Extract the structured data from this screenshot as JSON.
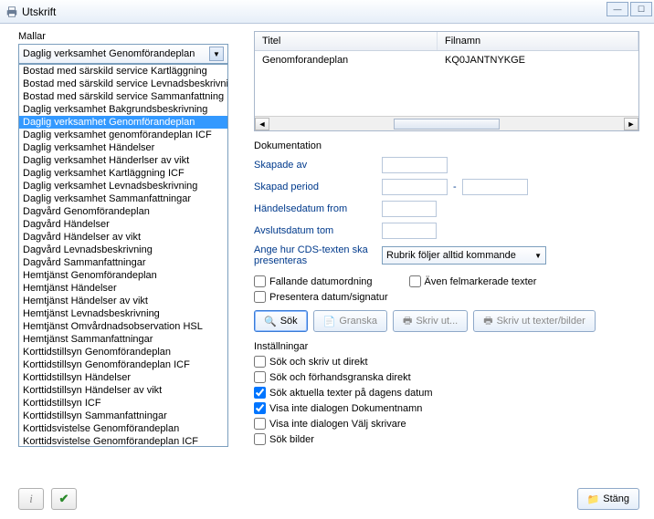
{
  "window": {
    "title": "Utskrift"
  },
  "mallar": {
    "label": "Mallar",
    "selected": "Daglig verksamhet Genomförandeplan",
    "items": [
      "Bostad med särskild service Kartläggning",
      "Bostad med särskild service Levnadsbeskrivning",
      "Bostad med särskild service Sammanfattning",
      "Daglig verksamhet Bakgrundsbeskrivning",
      "Daglig verksamhet Genomförandeplan",
      "Daglig verksamhet genomförandeplan ICF",
      "Daglig verksamhet Händelser",
      "Daglig verksamhet Händerlser av vikt",
      "Daglig verksamhet Kartläggning ICF",
      "Daglig verksamhet Levnadsbeskrivning",
      "Daglig verksamhet Sammanfattningar",
      "Dagvård Genomförandeplan",
      "Dagvård Händelser",
      "Dagvård Händelser av vikt",
      "Dagvård Levnadsbeskrivning",
      "Dagvård Sammanfattningar",
      "Hemtjänst Genomförandeplan",
      "Hemtjänst Händelser",
      "Hemtjänst Händelser av vikt",
      "Hemtjänst Levnadsbeskrivning",
      "Hemtjänst Omvårdnadsobservation HSL",
      "Hemtjänst Sammanfattningar",
      "Korttidstillsyn Genomförandeplan",
      "Korttidstillsyn Genomförandeplan ICF",
      "Korttidstillsyn Händelser",
      "Korttidstillsyn Händelser av vikt",
      "Korttidstillsyn ICF",
      "Korttidstillsyn Sammanfattningar",
      "Korttidsvistelse Genomförandeplan",
      "Korttidsvistelse Genomförandeplan ICF"
    ],
    "selected_index": 4
  },
  "table": {
    "headers": [
      "Titel",
      "Filnamn"
    ],
    "rows": [
      [
        "Genomforandeplan",
        "KQ0JANTNYKGE"
      ]
    ]
  },
  "dokumentation": {
    "label": "Dokumentation",
    "skapade_av": "Skapade av",
    "skapad_period": "Skapad period",
    "handelsedatum": "Händelsedatum from",
    "avslutsdatum": "Avslutsdatum tom",
    "cds_label": "Ange hur CDS-texten ska presenteras",
    "cds_value": "Rubrik följer alltid kommande",
    "fallande": "Fallande datumordning",
    "aven_fel": "Även felmarkerade texter",
    "presentera": "Presentera datum/signatur"
  },
  "buttons": {
    "sok": "Sök",
    "granska": "Granska",
    "skriv_ut": "Skriv ut...",
    "skriv_texter": "Skriv ut texter/bilder",
    "stang": "Stäng"
  },
  "installningar": {
    "label": "Inställningar",
    "items": [
      {
        "label": "Sök och skriv ut direkt",
        "checked": false
      },
      {
        "label": "Sök och förhandsgranska direkt",
        "checked": false
      },
      {
        "label": "Sök aktuella texter på dagens datum",
        "checked": true
      },
      {
        "label": "Visa inte dialogen Dokumentnamn",
        "checked": true
      },
      {
        "label": "Visa inte dialogen Välj skrivare",
        "checked": false
      },
      {
        "label": "Sök bilder",
        "checked": false
      }
    ]
  }
}
